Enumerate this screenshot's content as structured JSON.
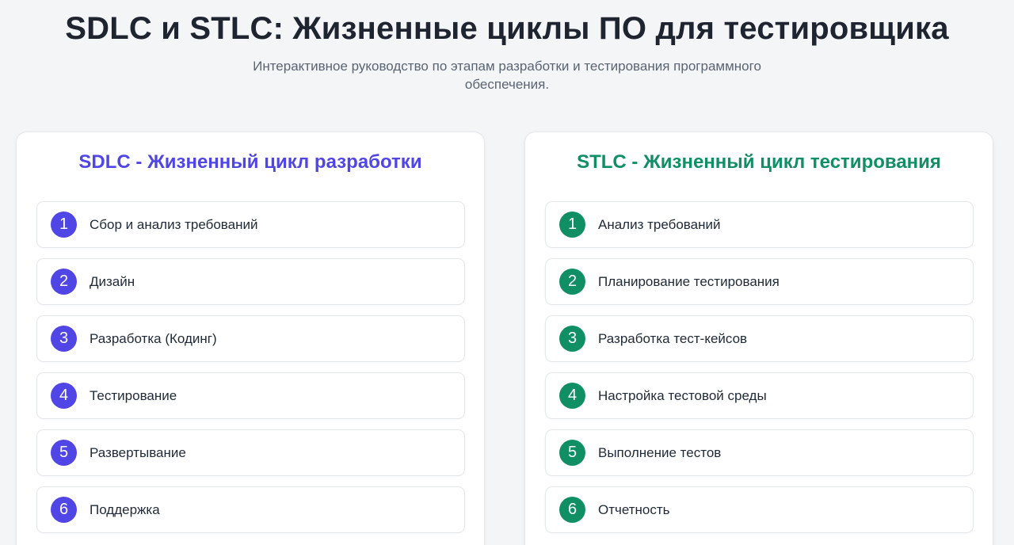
{
  "header": {
    "title": "SDLC и STLC: Жизненные циклы ПО для тестировщика",
    "subtitle_line1": "Интерактивное руководство по этапам разработки и тестирования программного",
    "subtitle_line2": "обеспечения."
  },
  "sdlc": {
    "title": "SDLC - Жизненный цикл разработки",
    "accent": "#4f46e5",
    "stages": [
      {
        "num": "1",
        "label": "Сбор и анализ требований"
      },
      {
        "num": "2",
        "label": "Дизайн"
      },
      {
        "num": "3",
        "label": "Разработка (Кодинг)"
      },
      {
        "num": "4",
        "label": "Тестирование"
      },
      {
        "num": "5",
        "label": "Развертывание"
      },
      {
        "num": "6",
        "label": "Поддержка"
      }
    ]
  },
  "stlc": {
    "title": "STLC - Жизненный цикл тестирования",
    "accent": "#0f8f63",
    "stages": [
      {
        "num": "1",
        "label": "Анализ требований"
      },
      {
        "num": "2",
        "label": "Планирование тестирования"
      },
      {
        "num": "3",
        "label": "Разработка тест-кейсов"
      },
      {
        "num": "4",
        "label": "Настройка тестовой среды"
      },
      {
        "num": "5",
        "label": "Выполнение тестов"
      },
      {
        "num": "6",
        "label": "Отчетность"
      }
    ]
  }
}
